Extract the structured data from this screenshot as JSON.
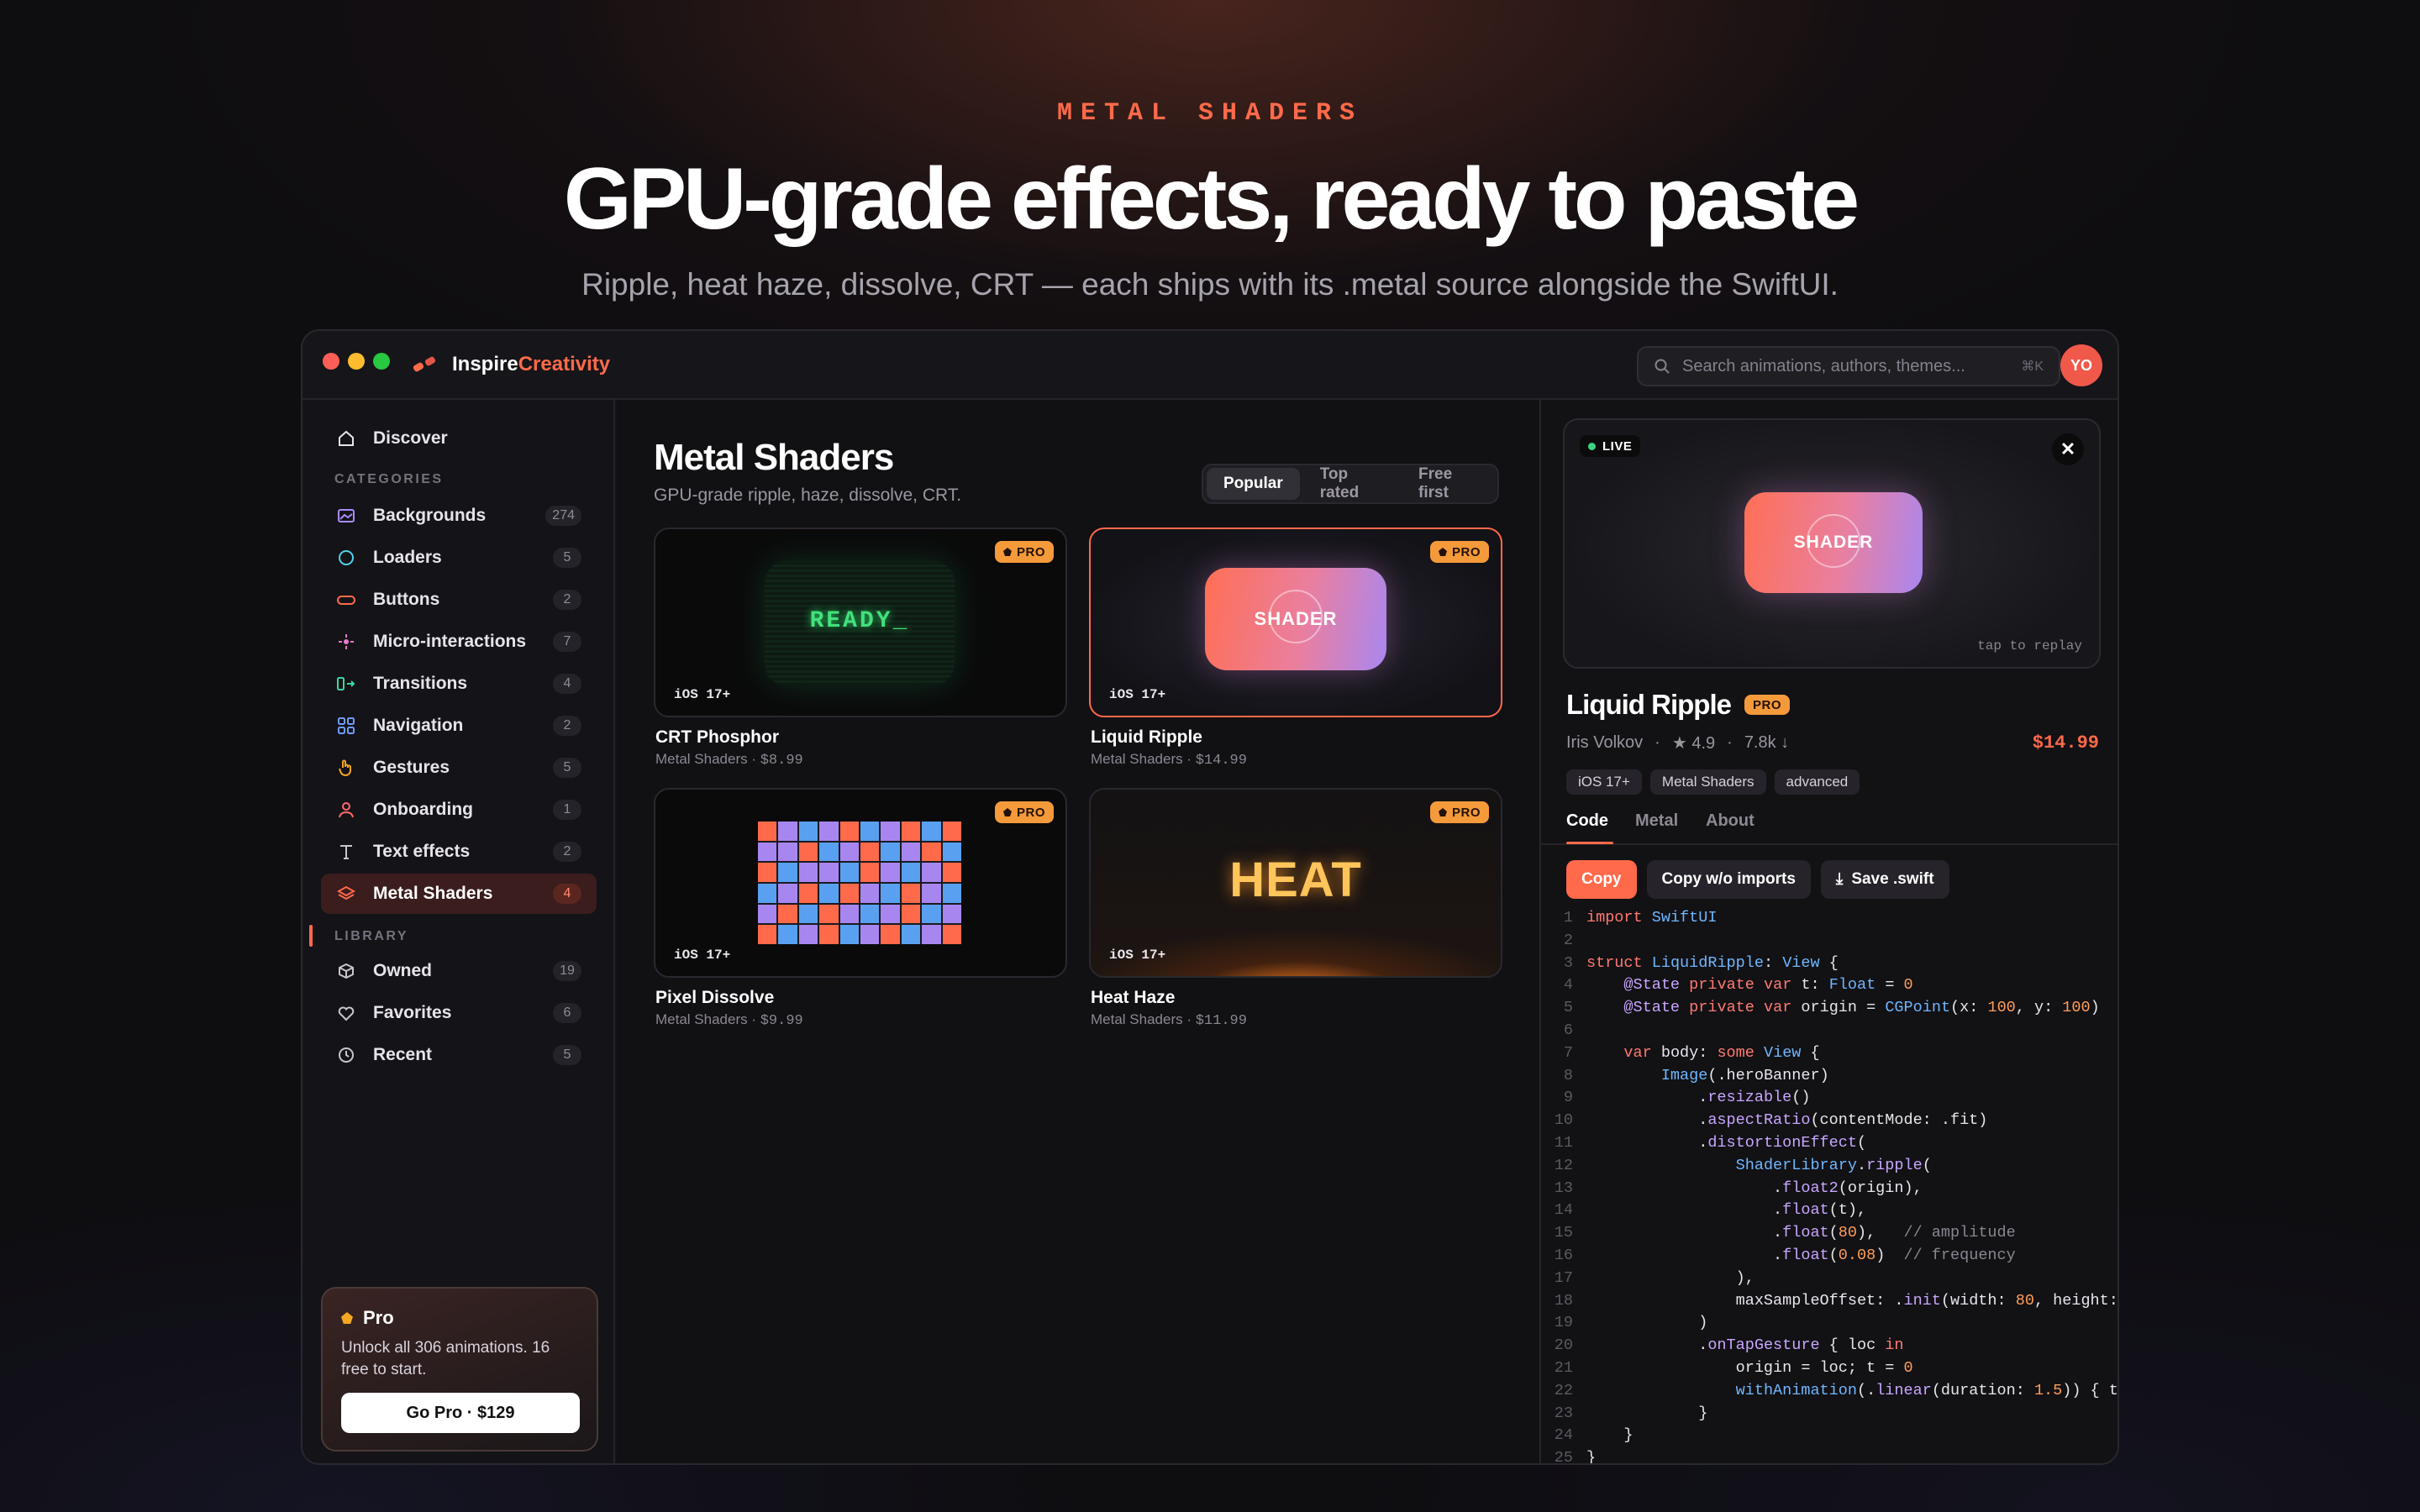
{
  "hero": {
    "eyebrow": "METAL SHADERS",
    "headline": "GPU-grade effects, ready to paste",
    "subhead": "Ripple, heat haze, dissolve, CRT — each ships with its .metal source alongside the SwiftUI."
  },
  "app": {
    "brand_1": "Inspire",
    "brand_2": "Creativity",
    "search_placeholder": "Search animations, authors, themes...",
    "search_shortcut": "⌘K",
    "avatar_initials": "YO",
    "accent": "#ff6a4a"
  },
  "sidebar": {
    "discover": "Discover",
    "categories_title": "CATEGORIES",
    "categories": [
      {
        "label": "Backgrounds",
        "count": "274",
        "icon": "image-icon"
      },
      {
        "label": "Loaders",
        "count": "5",
        "icon": "circle-icon"
      },
      {
        "label": "Buttons",
        "count": "2",
        "icon": "pill-icon"
      },
      {
        "label": "Micro-interactions",
        "count": "7",
        "icon": "sparkle-icon"
      },
      {
        "label": "Transitions",
        "count": "4",
        "icon": "transition-icon"
      },
      {
        "label": "Navigation",
        "count": "2",
        "icon": "grid-icon"
      },
      {
        "label": "Gestures",
        "count": "5",
        "icon": "hand-icon"
      },
      {
        "label": "Onboarding",
        "count": "1",
        "icon": "person-icon"
      },
      {
        "label": "Text effects",
        "count": "2",
        "icon": "text-icon"
      },
      {
        "label": "Metal Shaders",
        "count": "4",
        "icon": "layers-icon"
      }
    ],
    "library_title": "LIBRARY",
    "library": [
      {
        "label": "Owned",
        "count": "19",
        "icon": "box-icon"
      },
      {
        "label": "Favorites",
        "count": "6",
        "icon": "heart-icon"
      },
      {
        "label": "Recent",
        "count": "5",
        "icon": "clock-icon"
      }
    ],
    "pro": {
      "title": "Pro",
      "description": "Unlock all 306 animations. 16 free to start.",
      "button": "Go Pro · $129"
    }
  },
  "main": {
    "title": "Metal Shaders",
    "subtitle": "GPU-grade ripple, haze, dissolve, CRT.",
    "sort_options": [
      "Popular",
      "Top rated",
      "Free first"
    ],
    "sort_selected": "Popular",
    "cards": [
      {
        "title": "CRT Phosphor",
        "category": "Metal Shaders",
        "price": "$8.99",
        "badge": "PRO",
        "platform": "iOS 17+",
        "art_text": "READY_"
      },
      {
        "title": "Liquid Ripple",
        "category": "Metal Shaders",
        "price": "$14.99",
        "badge": "PRO",
        "platform": "iOS 17+",
        "art_text": "SHADER"
      },
      {
        "title": "Pixel Dissolve",
        "category": "Metal Shaders",
        "price": "$9.99",
        "badge": "PRO",
        "platform": "iOS 17+"
      },
      {
        "title": "Heat Haze",
        "category": "Metal Shaders",
        "price": "$11.99",
        "badge": "PRO",
        "platform": "iOS 17+",
        "art_text": "HEAT"
      }
    ]
  },
  "detail": {
    "live_label": "LIVE",
    "preview_text": "SHADER",
    "replay_hint": "tap to replay",
    "title": "Liquid Ripple",
    "badge": "PRO",
    "author": "Iris Volkov",
    "rating": "4.9",
    "downloads": "7.8k ↓",
    "price": "$14.99",
    "tags": [
      "iOS 17+",
      "Metal Shaders",
      "advanced"
    ],
    "tabs": [
      "Code",
      "Metal",
      "About"
    ],
    "tab_selected": "Code",
    "actions": {
      "copy": "Copy",
      "copy_no_imports": "Copy w/o imports",
      "save": "Save .swift"
    },
    "code_lines": [
      "import SwiftUI",
      "",
      "struct LiquidRipple: View {",
      "    @State private var t: Float = 0",
      "    @State private var origin = CGPoint(x: 100, y: 100)",
      "",
      "    var body: some View {",
      "        Image(.heroBanner)",
      "            .resizable()",
      "            .aspectRatio(contentMode: .fit)",
      "            .distortionEffect(",
      "                ShaderLibrary.ripple(",
      "                    .float2(origin),",
      "                    .float(t),",
      "                    .float(80),   // amplitude",
      "                    .float(0.08)  // frequency",
      "                ),",
      "                maxSampleOffset: .init(width: 80, height:",
      "            )",
      "            .onTapGesture { loc in",
      "                origin = loc; t = 0",
      "                withAnimation(.linear(duration: 1.5)) { t",
      "            }",
      "    }",
      "}"
    ]
  }
}
